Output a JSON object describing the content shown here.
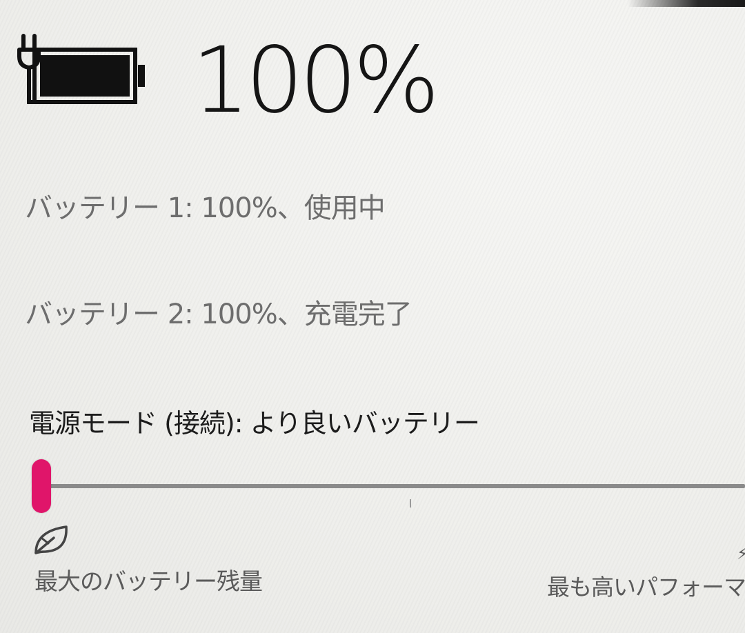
{
  "battery": {
    "icon": "battery-charging-icon",
    "charge_level": 1.0,
    "percent_text": "100%"
  },
  "batteries": [
    {
      "text": "バッテリー 1: 100%、使用中"
    },
    {
      "text": "バッテリー 2: 100%、充電完了"
    }
  ],
  "power_mode": {
    "label": "電源モード (接続): より良いバッテリー",
    "slider_value": 0.0,
    "thumb_color": "#e0156a",
    "min_icon": "leaf-icon",
    "min_label": "最大のバッテリー残量",
    "max_label": "最も高いパフォーマンス"
  },
  "colors": {
    "accent": "#e0156a",
    "background": "#f1f1ef",
    "secondary_text": "#6d6d6d"
  }
}
